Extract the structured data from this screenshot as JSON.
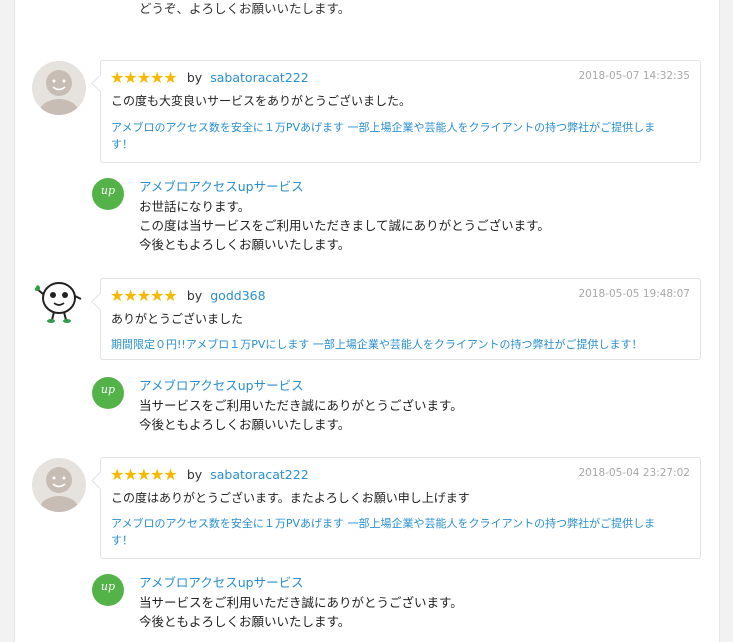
{
  "top_text": "どうぞ、よろしくお願いいたします。",
  "by_label": "by",
  "star_glyph": "★",
  "star_color": "#f5b900",
  "link_color": "#2a8fcf",
  "seller_icon_color": "#54b348",
  "seller_icon_text": "up",
  "reviews": [
    {
      "username": "sabatoracat222",
      "date": "2018-05-07 14:32:35",
      "rating": 5,
      "text": "この度も大変良いサービスをありがとうございました。",
      "service_line1": "アメブロのアクセス数を安全に１万PVあげます 一部上場企業や芸能人をクライアントの持つ弊社がご提供しま",
      "service_line2": "す！",
      "reply_seller": "アメブロアクセスupサービス",
      "reply_lines": [
        "お世話になります。",
        "この度は当サービスをご利用いただきまして誠にありがとうございます。",
        "今後ともよろしくお願いいたします。"
      ]
    },
    {
      "username": "godd368",
      "date": "2018-05-05 19:48:07",
      "rating": 5,
      "text": "ありがとうございました",
      "service_line1": "期間限定０円!!アメブロ１万PVにします 一部上場企業や芸能人をクライアントの持つ弊社がご提供します！",
      "reply_seller": "アメブロアクセスupサービス",
      "reply_lines": [
        "当サービスをご利用いただき誠にありがとうございます。",
        "今後ともよろしくお願いいたします。"
      ]
    },
    {
      "username": "sabatoracat222",
      "date": "2018-05-04 23:27:02",
      "rating": 5,
      "text": "この度はありがとうございます。またよろしくお願い申し上げます",
      "service_line1": "アメブロのアクセス数を安全に１万PVあげます 一部上場企業や芸能人をクライアントの持つ弊社がご提供しま",
      "service_line2": "す！",
      "reply_seller": "アメブロアクセスupサービス",
      "reply_lines": [
        "当サービスをご利用いただき誠にありがとうございます。",
        "今後ともよろしくお願いいたします。"
      ]
    }
  ]
}
